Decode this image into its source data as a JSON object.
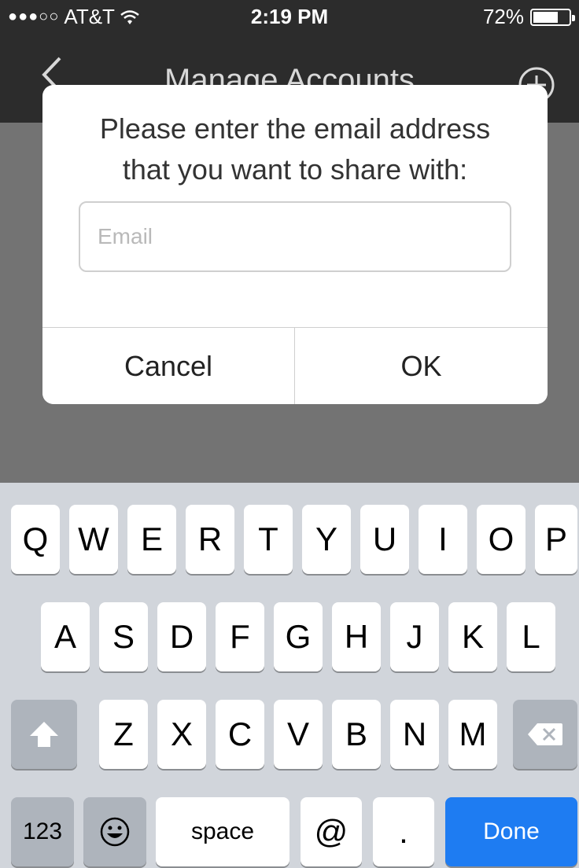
{
  "status_bar": {
    "signal": "●●●○○",
    "carrier": "AT&T",
    "time": "2:19 PM",
    "battery_text": "72%",
    "battery_level": 0.72
  },
  "nav": {
    "title": "Manage Accounts"
  },
  "alert": {
    "message_line1": "Please enter the email address",
    "message_line2": "that you want to share with:",
    "email_placeholder": "Email",
    "email_value": "",
    "cancel_label": "Cancel",
    "ok_label": "OK"
  },
  "keyboard": {
    "row1": [
      "Q",
      "W",
      "E",
      "R",
      "T",
      "Y",
      "U",
      "I",
      "O",
      "P"
    ],
    "row2": [
      "A",
      "S",
      "D",
      "F",
      "G",
      "H",
      "J",
      "K",
      "L"
    ],
    "row3": [
      "Z",
      "X",
      "C",
      "V",
      "B",
      "N",
      "M"
    ],
    "numbers_label": "123",
    "space_label": "space",
    "at_label": "@",
    "dot_label": ".",
    "done_label": "Done"
  },
  "colors": {
    "done_key": "#1e7cf2",
    "nav_background": "#2c2c2c",
    "dim_background": "#737373",
    "keyboard_background": "#d1d5db"
  }
}
